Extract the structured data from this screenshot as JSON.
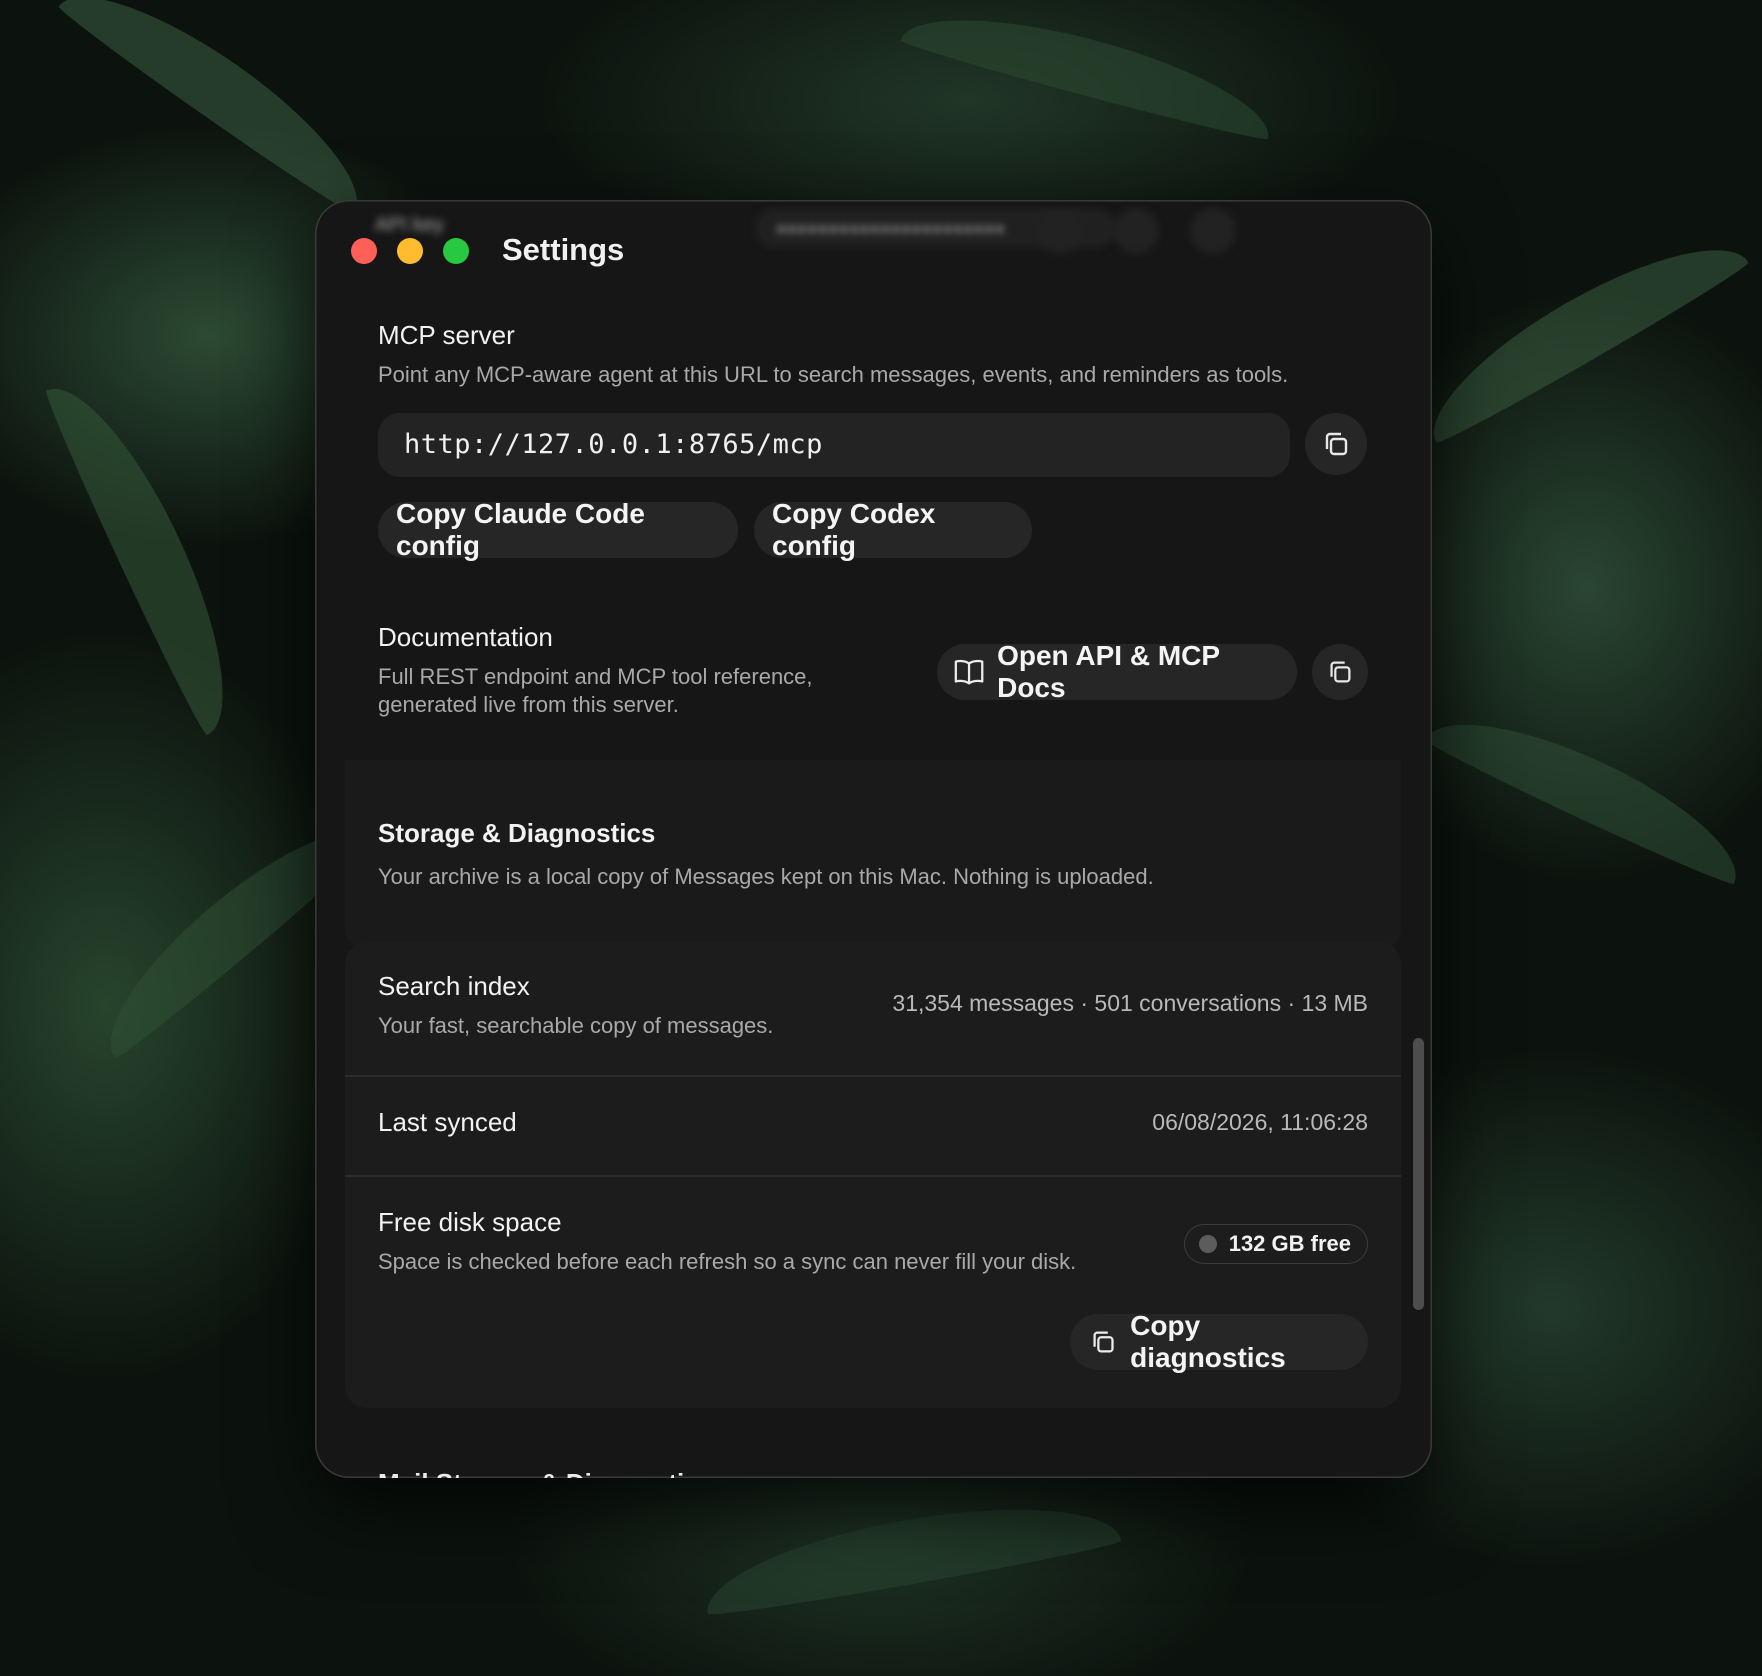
{
  "window": {
    "title": "Settings"
  },
  "blurred_header": {
    "label": "API key",
    "masked_value": "••••••••••••••••••••••"
  },
  "mcp": {
    "heading": "MCP server",
    "description": "Point any MCP-aware agent at this URL to search messages, events, and reminders as tools.",
    "url": "http://127.0.0.1:8765/mcp",
    "copy_claude_label": "Copy Claude Code config",
    "copy_codex_label": "Copy Codex config"
  },
  "docs": {
    "heading": "Documentation",
    "description_line1": "Full REST endpoint and MCP tool reference,",
    "description_line2": "generated live from this server.",
    "open_docs_label": "Open API & MCP Docs"
  },
  "storage": {
    "heading": "Storage & Diagnostics",
    "description": "Your archive is a local copy of Messages kept on this Mac. Nothing is uploaded.",
    "search_index": {
      "label": "Search index",
      "description": "Your fast, searchable copy of messages.",
      "stats": "31,354 messages · 501 conversations · 13 MB"
    },
    "last_synced": {
      "label": "Last synced",
      "value": "06/08/2026, 11:06:28"
    },
    "free_disk": {
      "label": "Free disk space",
      "description": "Space is checked before each refresh so a sync can never fill your disk.",
      "badge": "132 GB free"
    },
    "copy_diagnostics_label": "Copy diagnostics"
  },
  "next_section_partial": "Mail Storage & Diagnostics",
  "icons": [
    "copy-icon",
    "book-icon"
  ],
  "colors": {
    "close": "#fe5f57",
    "minimize": "#febc2e",
    "zoom": "#28c840"
  }
}
